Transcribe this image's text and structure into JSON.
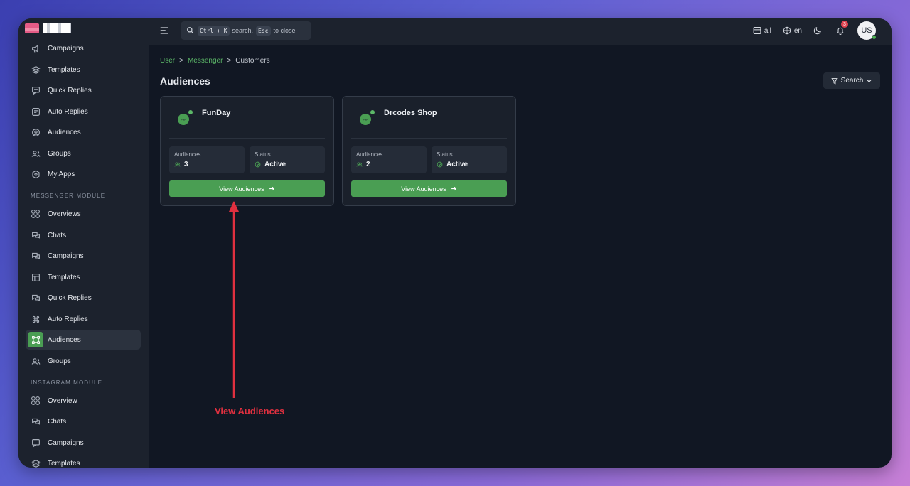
{
  "sidebar": {
    "items_top": [
      {
        "label": "Campaigns",
        "icon": "megaphone-icon"
      },
      {
        "label": "Templates",
        "icon": "layers-icon"
      },
      {
        "label": "Quick Replies",
        "icon": "chat-bubble-icon"
      },
      {
        "label": "Auto Replies",
        "icon": "auto-reply-icon"
      },
      {
        "label": "Audiences",
        "icon": "user-circle-icon"
      },
      {
        "label": "Groups",
        "icon": "users-icon"
      },
      {
        "label": "My Apps",
        "icon": "apps-icon"
      }
    ],
    "messenger_section": "MESSENGER MODULE",
    "messenger_items": [
      {
        "label": "Overviews",
        "icon": "grid-icon"
      },
      {
        "label": "Chats",
        "icon": "chats-icon"
      },
      {
        "label": "Campaigns",
        "icon": "megaphone-icon"
      },
      {
        "label": "Templates",
        "icon": "layout-icon"
      },
      {
        "label": "Quick Replies",
        "icon": "chats-icon"
      },
      {
        "label": "Auto Replies",
        "icon": "command-icon"
      },
      {
        "label": "Audiences",
        "icon": "audience-icon",
        "active": true
      },
      {
        "label": "Groups",
        "icon": "users-icon"
      }
    ],
    "instagram_section": "INSTAGRAM MODULE",
    "instagram_items": [
      {
        "label": "Overview",
        "icon": "grid-icon"
      },
      {
        "label": "Chats",
        "icon": "chats-icon"
      },
      {
        "label": "Campaigns",
        "icon": "chat-bubble-icon"
      },
      {
        "label": "Templates",
        "icon": "layers-icon"
      }
    ]
  },
  "topbar": {
    "search_kbd1": "Ctrl + K",
    "search_text1": "search,",
    "search_kbd2": "Esc",
    "search_text2": "to close",
    "all_label": "all",
    "lang_label": "en",
    "notif_count": "3",
    "avatar_initials": "US"
  },
  "breadcrumb": {
    "items": [
      "User",
      "Messenger",
      "Customers"
    ],
    "sep": ">"
  },
  "page": {
    "title": "Audiences",
    "search_label": "Search"
  },
  "cards": [
    {
      "name": "FunDay",
      "aud_label": "Audiences",
      "aud_value": "3",
      "status_label": "Status",
      "status_value": "Active",
      "button": "View Audiences"
    },
    {
      "name": "Drcodes Shop",
      "aud_label": "Audiences",
      "aud_value": "2",
      "status_label": "Status",
      "status_value": "Active",
      "button": "View Audiences"
    }
  ],
  "annotation": {
    "text": "View Audiences",
    "color": "#e0303f"
  },
  "colors": {
    "accent": "#4a9e53",
    "link": "#5cb868",
    "background": "#111723"
  }
}
